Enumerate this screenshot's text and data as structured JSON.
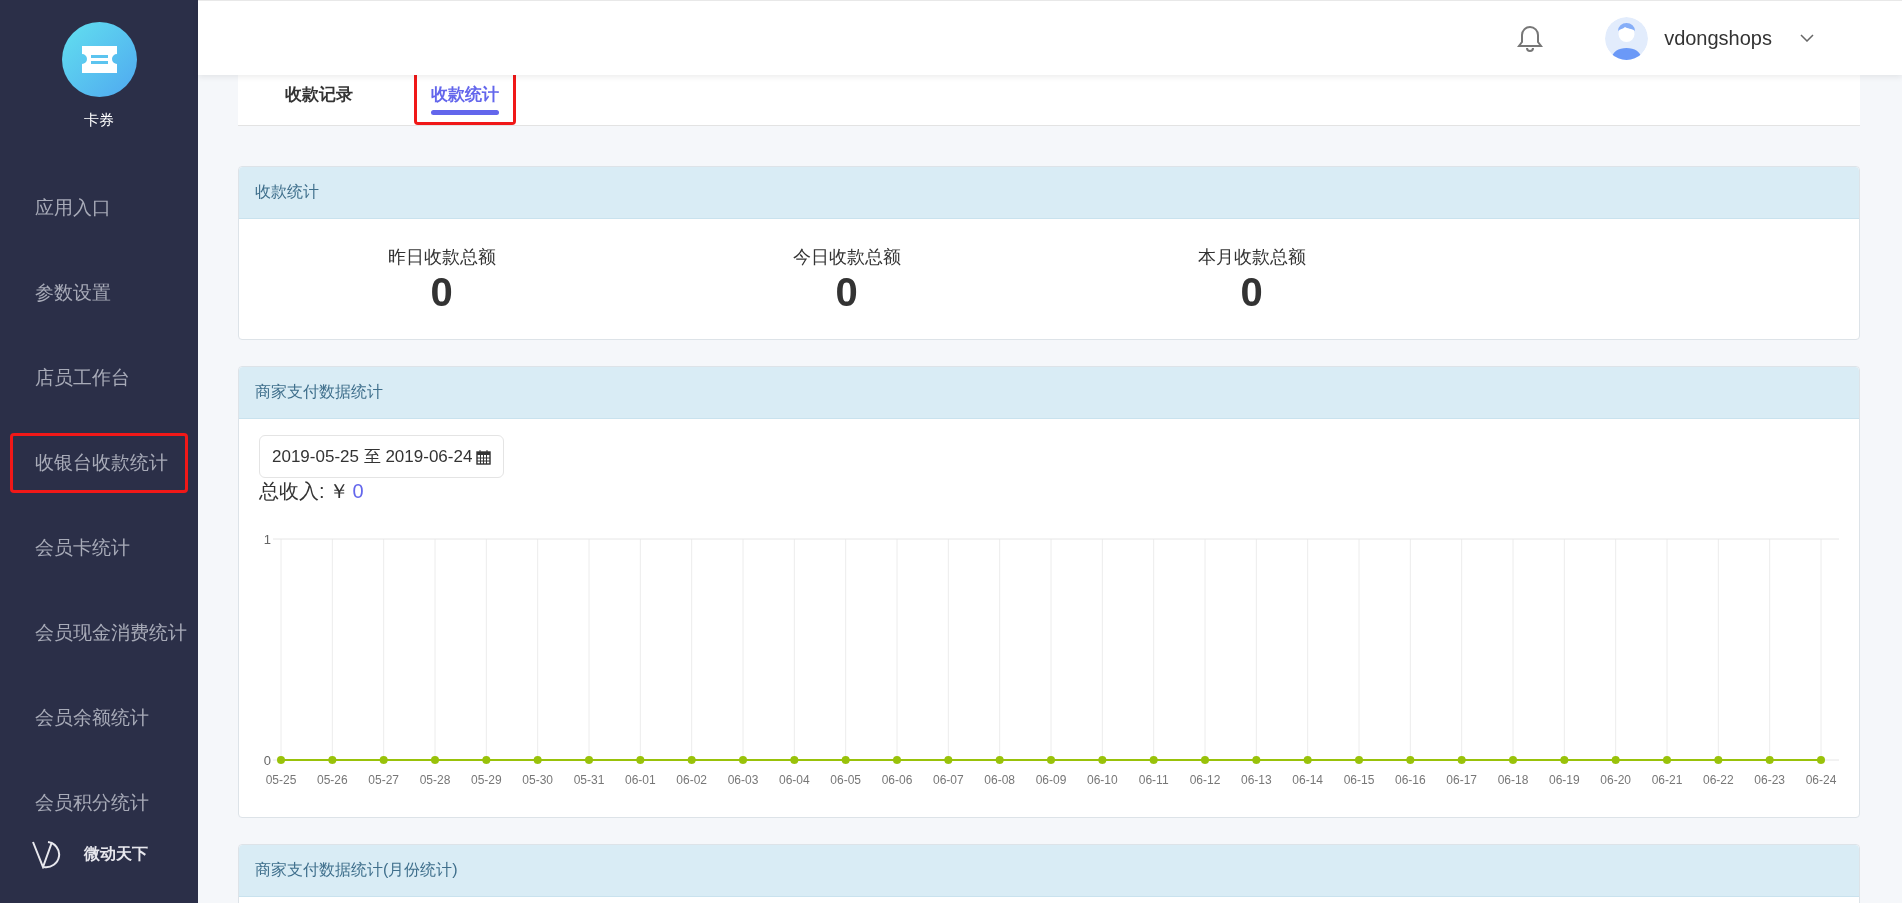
{
  "sidebar": {
    "app_name": "卡券",
    "items": [
      {
        "label": "应用入口",
        "selected": false
      },
      {
        "label": "参数设置",
        "selected": false
      },
      {
        "label": "店员工作台",
        "selected": false
      },
      {
        "label": "收银台收款统计",
        "selected": true
      },
      {
        "label": "会员卡统计",
        "selected": false
      },
      {
        "label": "会员现金消费统计",
        "selected": false
      },
      {
        "label": "会员余额统计",
        "selected": false
      },
      {
        "label": "会员积分统计",
        "selected": false
      }
    ],
    "brand": "微动天下"
  },
  "header": {
    "username": "vdongshops"
  },
  "tabs": [
    {
      "label": "收款记录",
      "selected": false
    },
    {
      "label": "收款统计",
      "selected": true
    }
  ],
  "summary_panel": {
    "title": "收款统计",
    "stats": [
      {
        "label": "昨日收款总额",
        "value": "0"
      },
      {
        "label": "今日收款总额",
        "value": "0"
      },
      {
        "label": "本月收款总额",
        "value": "0"
      }
    ]
  },
  "payment_panel": {
    "title": "商家支付数据统计",
    "date_range": "2019-05-25 至 2019-06-24",
    "total_label": "总收入:",
    "currency": "￥",
    "total": "0",
    "chart_data": {
      "type": "line",
      "categories": [
        "05-25",
        "05-26",
        "05-27",
        "05-28",
        "05-29",
        "05-30",
        "05-31",
        "06-01",
        "06-02",
        "06-03",
        "06-04",
        "06-05",
        "06-06",
        "06-07",
        "06-08",
        "06-09",
        "06-10",
        "06-11",
        "06-12",
        "06-13",
        "06-14",
        "06-15",
        "06-16",
        "06-17",
        "06-18",
        "06-19",
        "06-20",
        "06-21",
        "06-22",
        "06-23",
        "06-24"
      ],
      "grid": true,
      "series": [
        {
          "color": "#99c20a",
          "marker": "circle",
          "values": [
            0,
            0,
            0,
            0,
            0,
            0,
            0,
            0,
            0,
            0,
            0,
            0,
            0,
            0,
            0,
            0,
            0,
            0,
            0,
            0,
            0,
            0,
            0,
            0,
            0,
            0,
            0,
            0,
            0,
            0,
            0
          ]
        }
      ],
      "ylim": [
        0,
        1
      ],
      "yticks": [
        0,
        1
      ]
    }
  },
  "monthly_panel": {
    "title": "商家支付数据统计(月份统计)"
  }
}
